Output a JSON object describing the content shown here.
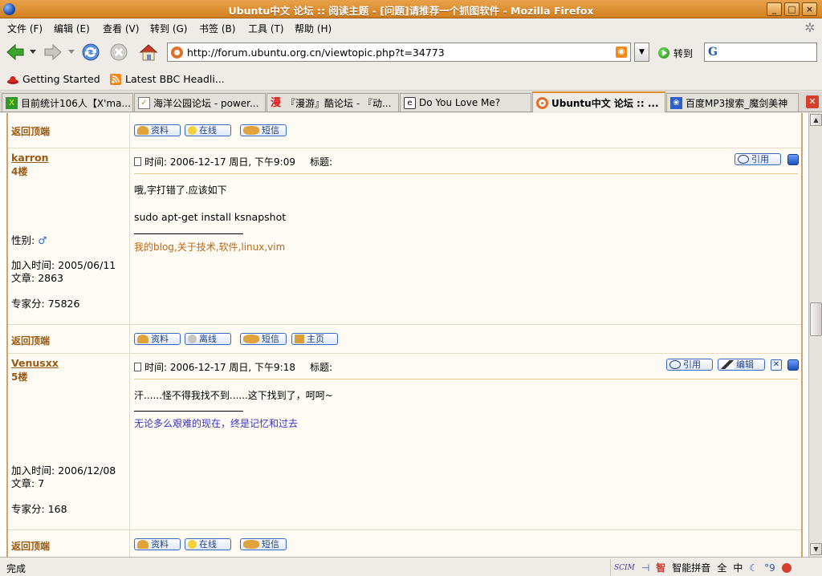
{
  "window": {
    "title": "Ubuntu中文 论坛 :: 阅读主题 - [问题]请推荐一个抓图软件 - Mozilla Firefox",
    "min_label": "_",
    "max_label": "□",
    "close_label": "×"
  },
  "menu": {
    "file": "文件 (F)",
    "edit": "编辑 (E)",
    "view": "查看 (V)",
    "go": "转到 (G)",
    "bookmarks": "书签 (B)",
    "tools": "工具 (T)",
    "help": "帮助 (H)"
  },
  "nav": {
    "url": "http://forum.ubuntu.org.cn/viewtopic.php?t=34773",
    "go_label": "转到"
  },
  "bookmarks": [
    {
      "label": "Getting Started",
      "icon": "red-hat-icon"
    },
    {
      "label": "Latest BBC Headli...",
      "icon": "rss-feed-icon"
    }
  ],
  "tabs": [
    {
      "label": "目前统计106人【X'ma...",
      "active": false
    },
    {
      "label": "海洋公园论坛 - power...",
      "active": false
    },
    {
      "label": "『漫游』酷论坛 - 『动...",
      "active": false
    },
    {
      "label": "Do You Love Me?",
      "active": false
    },
    {
      "label": "Ubuntu中文 论坛 :: ...",
      "active": true
    },
    {
      "label": "百度MP3搜索_魔剑美神",
      "active": false
    }
  ],
  "forum": {
    "back_to_top": "返回顶端",
    "buttons": {
      "profile": "资料",
      "online": "在线",
      "offline": "离线",
      "pm": "短信",
      "homepage": "主页",
      "quote": "引用",
      "edit": "编辑"
    },
    "labels": {
      "gender": "性别:",
      "joined": "加入时间:",
      "posts": "文章:",
      "expert": "专家分:",
      "subject": "标题:"
    },
    "posts": [
      {
        "username": "karron",
        "floor": "4楼",
        "gender_symbol": "♂",
        "joined": "2005/06/11",
        "post_count": "2863",
        "expert_score": "75826",
        "time": "时间: 2006-12-17 周日, 下午9:09",
        "lines": [
          "哦,字打错了.应该如下",
          "sudo apt-get install ksnapshot"
        ],
        "signature": "我的blog,关于技术,软件,linux,vim"
      },
      {
        "username": "Venusxx",
        "floor": "5楼",
        "joined": "2006/12/08",
        "post_count": "7",
        "expert_score": "168",
        "time": "时间: 2006-12-17 周日, 下午9:18",
        "lines": [
          "汗......怪不得我找不到......这下找到了，呵呵~"
        ],
        "signature": "无论多么艰难的现在，终是记忆和过去"
      }
    ]
  },
  "status": {
    "text": "完成",
    "ime_name": "智能拼音",
    "ime_full": "全",
    "ime_lang": "中",
    "ime_punct": "°9",
    "scim_label": "SCIM"
  },
  "colors": {
    "title_bar": "#d98a2b",
    "forum_border": "#d8a262",
    "link_brown": "#9b5a14",
    "button_blue": "#1d3f8a",
    "signature_blue": "#3535c8",
    "signature_brown": "#b86a1a"
  }
}
